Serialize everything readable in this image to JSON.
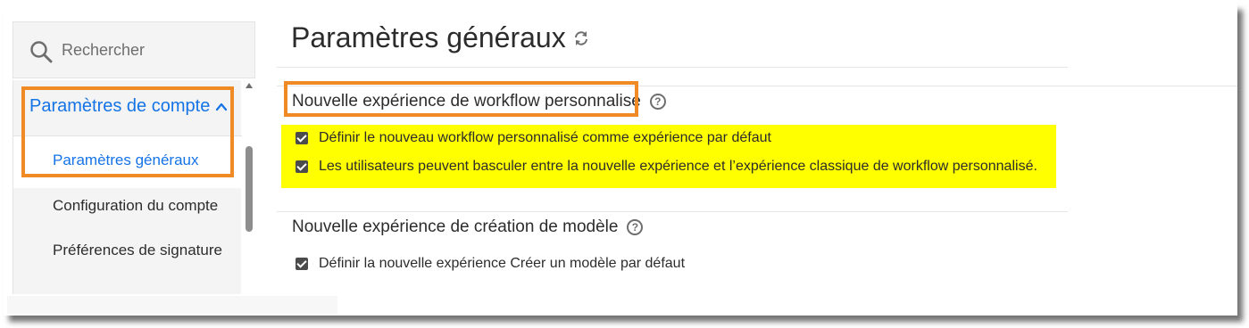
{
  "search": {
    "placeholder": "Rechercher",
    "icon": "search-icon"
  },
  "sidebar": {
    "section_label": "Paramètres de compte",
    "items": [
      {
        "label": "Paramètres généraux",
        "active": true
      },
      {
        "label": "Configuration du compte",
        "active": false
      },
      {
        "label": "Préférences de signature",
        "active": false
      }
    ]
  },
  "main": {
    "title": "Paramètres généraux",
    "sections": [
      {
        "title": "Nouvelle expérience de workflow personnalisé",
        "options": [
          {
            "label": "Définir le nouveau workflow personnalisé comme expérience par défaut",
            "checked": true
          },
          {
            "label": "Les utilisateurs peuvent basculer entre la nouvelle expérience et l’expérience classique de workflow personnalisé.",
            "checked": true
          }
        ]
      },
      {
        "title": "Nouvelle expérience de création de modèle",
        "options": [
          {
            "label": "Définir la nouvelle expérience Créer un modèle par défaut",
            "checked": true
          }
        ]
      }
    ]
  },
  "colors": {
    "accent": "#1473e6",
    "annotation_box": "#f08a24",
    "highlight": "#ffff00"
  }
}
